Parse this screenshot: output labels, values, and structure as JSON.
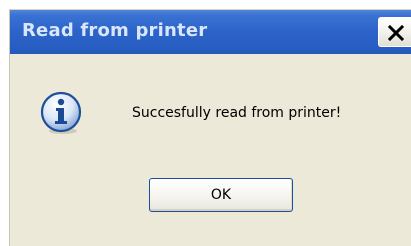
{
  "window": {
    "title": "Read from printer",
    "close_label": "×"
  },
  "dialog": {
    "icon": "info-icon",
    "message": "Succesfully read from printer!",
    "ok_label": "OK"
  },
  "colors": {
    "titlebar": "#2c63c9",
    "dialog_background": "#ece9d8",
    "button_border": "#1c4fa0"
  }
}
